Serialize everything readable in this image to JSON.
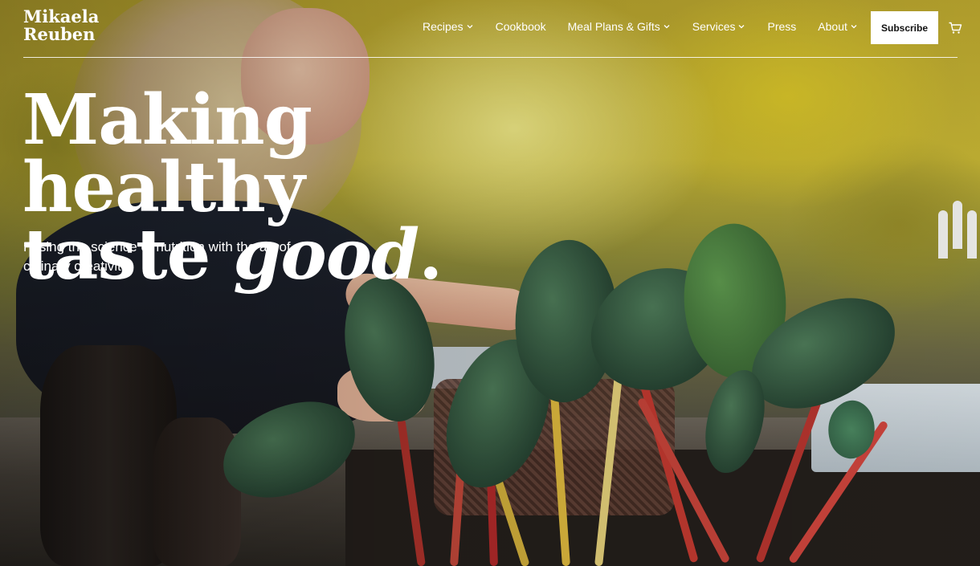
{
  "brand": {
    "line1": "Mikaela",
    "line2": "Reuben"
  },
  "nav": {
    "items": [
      {
        "label": "Recipes",
        "has_dropdown": true
      },
      {
        "label": "Cookbook",
        "has_dropdown": false
      },
      {
        "label": "Meal Plans & Gifts",
        "has_dropdown": true
      },
      {
        "label": "Services",
        "has_dropdown": true
      },
      {
        "label": "Press",
        "has_dropdown": false
      },
      {
        "label": "About",
        "has_dropdown": true
      }
    ],
    "subscribe_label": "Subscribe",
    "cart_icon": "cart-icon"
  },
  "hero": {
    "headline_line1": "Making healthy",
    "headline_line2_plain": "taste ",
    "headline_line2_italic": "good",
    "headline_line2_end": ".",
    "subtitle": "Fusing the science of nutrition with the art of culinary creativity."
  },
  "colors": {
    "text": "#ffffff",
    "button_bg": "#ffffff",
    "button_text": "#111111"
  }
}
